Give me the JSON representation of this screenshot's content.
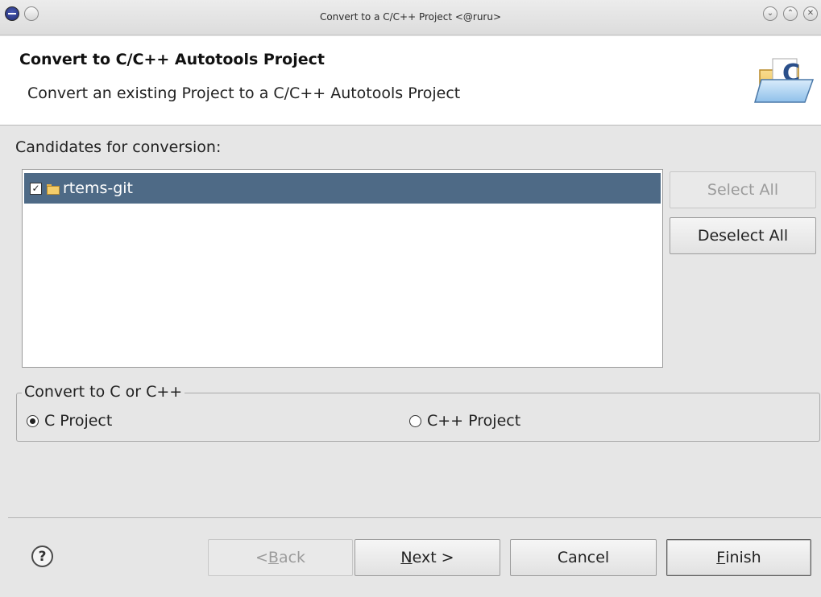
{
  "window": {
    "title": "Convert to a C/C++ Project  <@ruru>"
  },
  "banner": {
    "title": "Convert to C/C++ Autotools Project",
    "description": "Convert an existing Project to a C/C++ Autotools Project",
    "icon": "folder-c-icon"
  },
  "candidates": {
    "label": "Candidates for conversion:",
    "items": [
      {
        "label": "rtems-git",
        "checked": true,
        "selected": true
      }
    ],
    "select_all": "Select All",
    "deselect_all": "Deselect All"
  },
  "convert_group": {
    "legend": "Convert to C or C++",
    "options": [
      {
        "label": "C Project",
        "selected": true
      },
      {
        "label": "C++ Project",
        "selected": false
      }
    ]
  },
  "footer": {
    "help_symbol": "?",
    "back": {
      "pre": "< ",
      "mnemonic": "B",
      "rest": "ack"
    },
    "next": {
      "mnemonic": "N",
      "rest": "ext >"
    },
    "cancel": "Cancel",
    "finish": {
      "mnemonic": "F",
      "rest": "inish"
    }
  },
  "colors": {
    "selection": "#4e6a86",
    "background": "#e6e6e6"
  }
}
